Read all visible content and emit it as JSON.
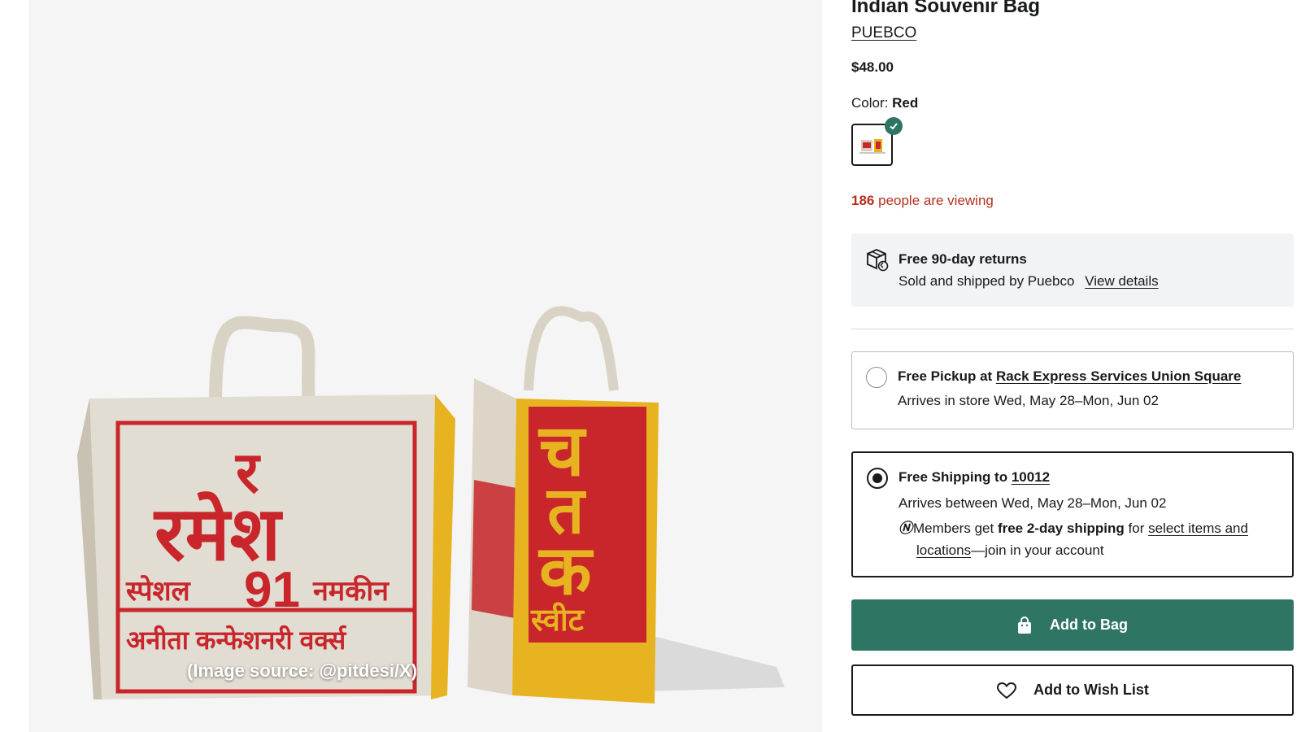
{
  "product": {
    "title": "Indian Souvenir Bag",
    "brand": "PUEBCO",
    "price": "$48.00",
    "color_label": "Color:",
    "color_value": "Red",
    "viewing_count": "186",
    "viewing_text": "people are viewing"
  },
  "image": {
    "caption": "(Image source: @pitdesi/X)",
    "bag_left_lines": [
      "र",
      "रमेश",
      "91",
      "स्पेशल",
      "नमकीन",
      "अनीता कन्फेशनरी वर्क्स"
    ],
    "bag_right_lines": [
      "च",
      "त",
      "क",
      "स्वीट"
    ]
  },
  "returns": {
    "title": "Free 90-day returns",
    "sub": "Sold and shipped by Puebco",
    "link": "View details"
  },
  "pickup": {
    "title_prefix": "Free Pickup at",
    "store": "Rack Express Services Union Square",
    "arrival": "Arrives in store Wed, May 28–Mon, Jun 02"
  },
  "shipping": {
    "title_prefix": "Free Shipping to",
    "zip": "10012",
    "arrival": "Arrives between Wed, May 28–Mon, Jun 02",
    "member_prefix": "Members get",
    "member_bold": "free 2-day shipping",
    "member_for": "for",
    "member_link1": "select items and",
    "member_link2": "locations",
    "member_suffix": "—join in your account"
  },
  "buttons": {
    "add_to_bag": "Add to Bag",
    "add_to_wish_list": "Add to Wish List"
  },
  "colors": {
    "primary_green": "#2f7564",
    "urgency_red": "#b4301f",
    "bag_red": "#c8262b",
    "bag_yellow": "#e8b321"
  },
  "icons": [
    "returns-box-icon",
    "check-icon",
    "bag-icon",
    "heart-icon",
    "nordy-club-icon"
  ]
}
